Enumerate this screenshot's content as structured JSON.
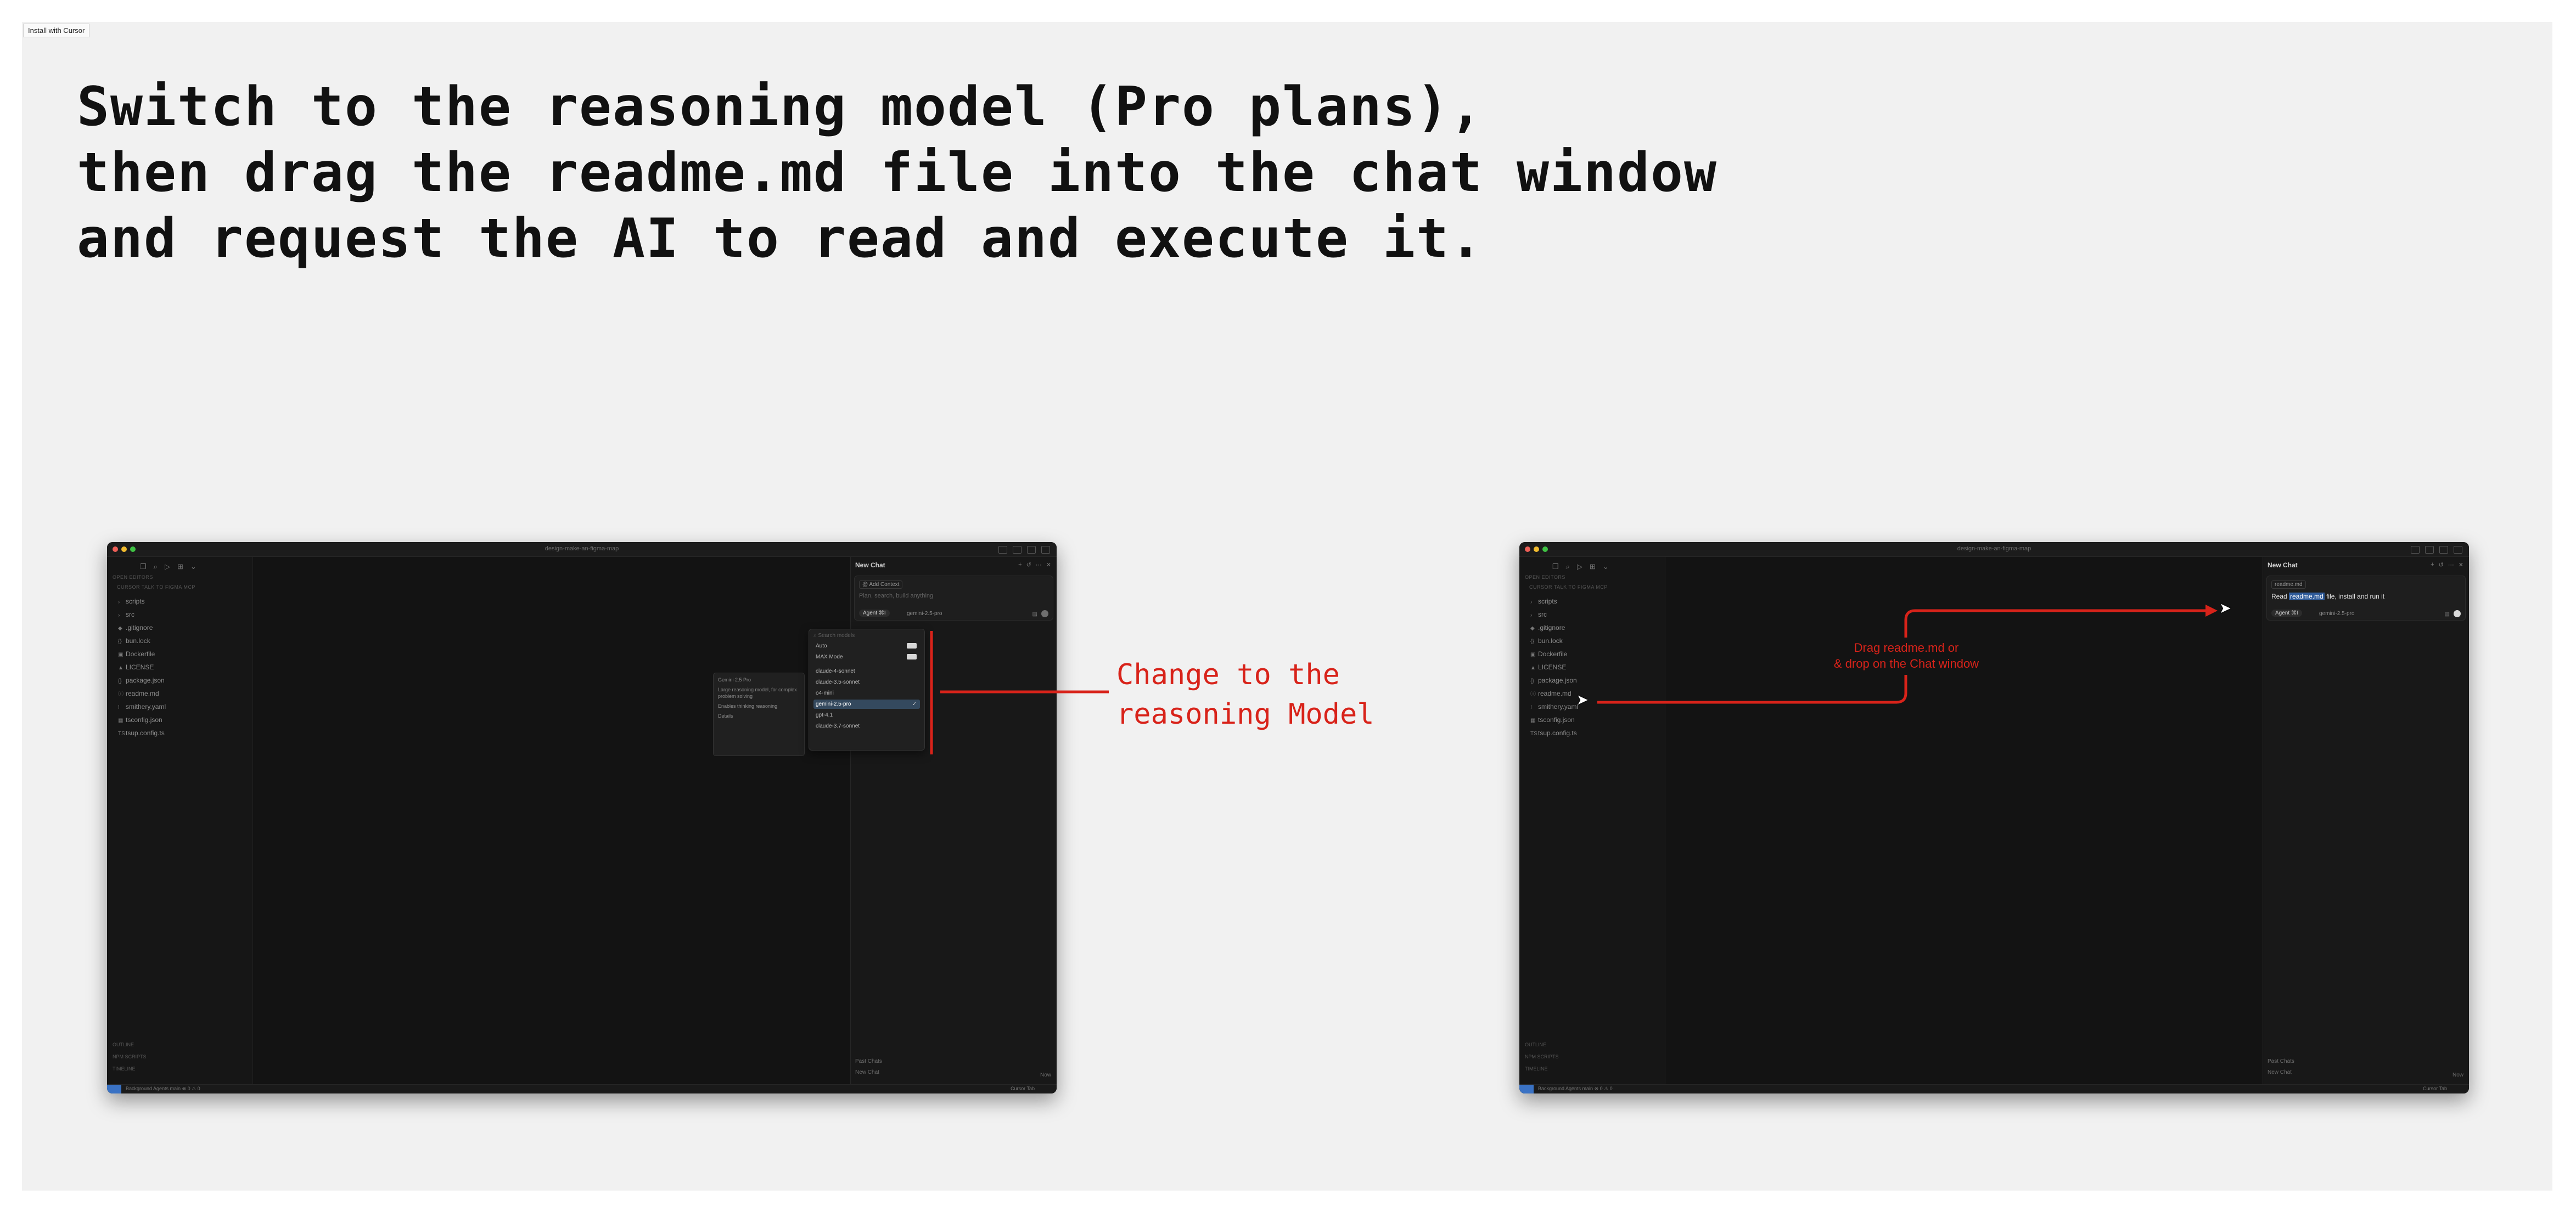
{
  "install_tag": "Install with Cursor",
  "headline": {
    "line1": "Switch to the reasoning model (Pro plans),",
    "line2": "then drag the readme.md file into the chat window",
    "line3": "and request the AI to read and execute it."
  },
  "window": {
    "title": "design-make-an-figma-map",
    "sidebar_header": "OPEN EDITORS",
    "project_header": "CURSOR TALK TO FIGMA MCP",
    "files": [
      {
        "name": "scripts",
        "icon": "›"
      },
      {
        "name": "src",
        "icon": "›"
      },
      {
        "name": ".gitignore",
        "icon": "◆"
      },
      {
        "name": "bun.lock",
        "icon": "{}"
      },
      {
        "name": "Dockerfile",
        "icon": "▣"
      },
      {
        "name": "LICENSE",
        "icon": "▲"
      },
      {
        "name": "package.json",
        "icon": "{}"
      },
      {
        "name": "readme.md",
        "icon": "ⓘ"
      },
      {
        "name": "smithery.yaml",
        "icon": "!"
      },
      {
        "name": "tsconfig.json",
        "icon": "▦"
      },
      {
        "name": "tsup.config.ts",
        "icon": "TS"
      }
    ],
    "outline": "OUTLINE",
    "npm_scripts": "NPM SCRIPTS",
    "timeline": "TIMELINE",
    "chat_title": "New Chat",
    "add_context": "@ Add Context",
    "chat_placeholder": "Plan, search, build anything",
    "agent_label": "Agent ⌘I",
    "model_label": "gemini-2.5-pro",
    "past_chats": "Past Chats",
    "new_chat": "New Chat",
    "now": "Now",
    "status_left": "Background Agents   main   ⊗ 0 ⚠ 0",
    "status_right": "Cursor Tab"
  },
  "dropdown": {
    "search": "⌕ Search models",
    "items": [
      "Auto",
      "MAX Mode",
      "claude-4-sonnet",
      "claude-3.5-sonnet",
      "o4-mini",
      "gemini-2.5-pro",
      "gpt-4.1",
      "claude-3.7-sonnet"
    ],
    "selected_index": 5
  },
  "tooltip": {
    "line1": "Gemini 2.5 Pro",
    "line2": "Large reasoning model, for complex problem solving",
    "line3": "Enables thinking reasoning",
    "line4": "Details"
  },
  "annotations": {
    "change_model_line1": "Change to the",
    "change_model_line2": "reasoning Model",
    "drag_line1": "Drag readme.md or",
    "drag_line2": "& drop on the Chat window"
  },
  "right_chat": {
    "chip": "readme.md",
    "typed_hl": "readme.md",
    "typed_prefix": "Read ",
    "typed_suffix": " file, install and run it"
  },
  "colors": {
    "annotation": "#d8231a",
    "window_bg": "#141414",
    "canvas_bg": "#f1f1f1",
    "selection": "#34495e"
  }
}
